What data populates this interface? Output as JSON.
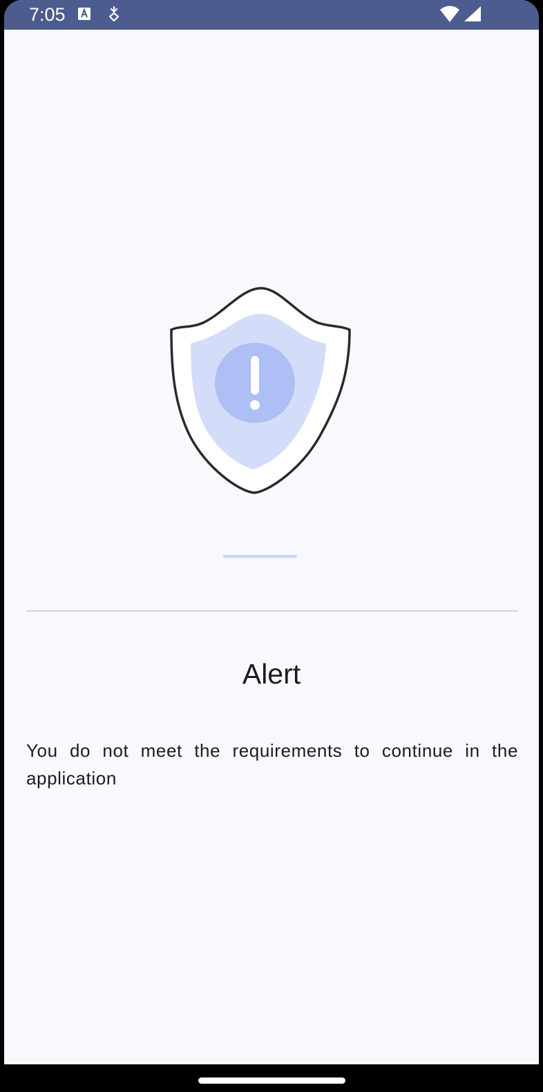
{
  "status_bar": {
    "time": "7:05",
    "icons": [
      "keyboard-a-icon",
      "download-shield-icon",
      "wifi-icon",
      "cellular-signal-icon"
    ],
    "background": "#4d5c8f"
  },
  "dialog": {
    "title": "Alert",
    "message": "You do not meet the requirements to continue in the application",
    "illustration": "shield-warning-icon"
  },
  "colors": {
    "background": "#f7f9fd",
    "shield_outer": "#ffffff",
    "shield_inner": "#d3ddfa",
    "shield_circle": "#adbff5",
    "accent_line": "#c7d5f7",
    "text": "#1b1c20"
  }
}
